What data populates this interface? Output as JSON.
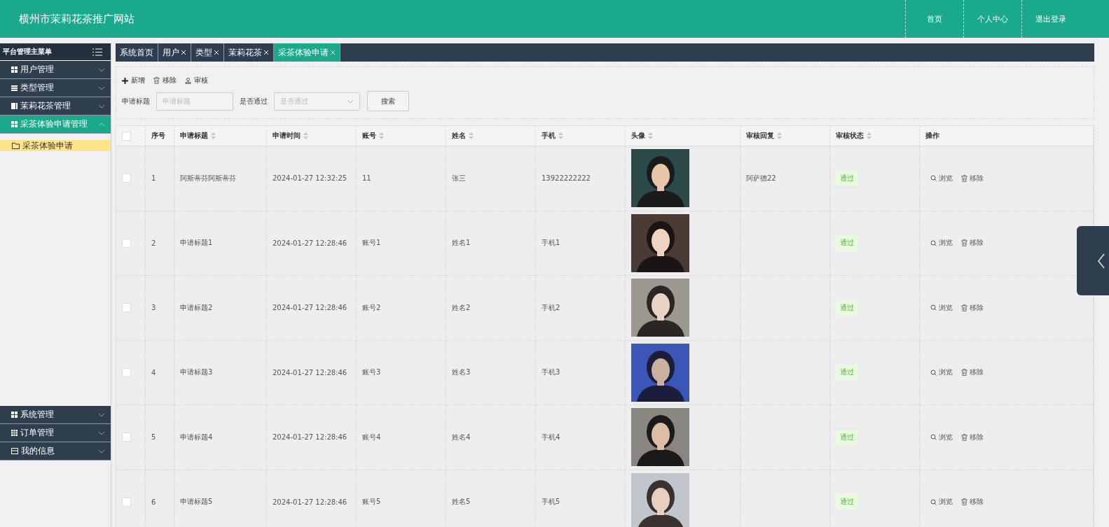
{
  "header": {
    "title": "横州市茉莉花茶推广网站",
    "nav": [
      "首页",
      "个人中心",
      "退出登录"
    ]
  },
  "sidebar": {
    "title": "平台管理主菜单",
    "top_items": [
      {
        "label": "用户管理",
        "kind": "grid",
        "expanded": false
      },
      {
        "label": "类型管理",
        "kind": "list",
        "expanded": false
      },
      {
        "label": "茉莉花茶管理",
        "kind": "book",
        "expanded": false
      },
      {
        "label": "采茶体验申请管理",
        "kind": "grid",
        "expanded": true,
        "children": [
          {
            "label": "采茶体验申请",
            "selected": true
          }
        ]
      }
    ],
    "bottom_items": [
      {
        "label": "系统管理",
        "kind": "grid",
        "expanded": false
      },
      {
        "label": "订单管理",
        "kind": "table",
        "expanded": false
      },
      {
        "label": "我的信息",
        "kind": "card",
        "expanded": false
      }
    ]
  },
  "tabs": [
    {
      "label": "系统首页",
      "closable": false,
      "selected": false
    },
    {
      "label": "用户",
      "closable": true,
      "selected": false
    },
    {
      "label": "类型",
      "closable": true,
      "selected": false
    },
    {
      "label": "茉莉花茶",
      "closable": true,
      "selected": false
    },
    {
      "label": "采茶体验申请",
      "closable": true,
      "selected": true
    }
  ],
  "toolbar": {
    "buttons": [
      {
        "label": "新增",
        "kind": "add"
      },
      {
        "label": "移除",
        "kind": "delete"
      },
      {
        "label": "审核",
        "kind": "stamp"
      }
    ],
    "search": [
      {
        "label": "申请标题",
        "kind": "input",
        "placeholder": "申请标题"
      },
      {
        "label": "是否通过",
        "kind": "select",
        "placeholder": "是否通过"
      }
    ],
    "search_button": "搜索"
  },
  "table": {
    "header_checkbox": {
      "checked": false
    },
    "columns": [
      {
        "label": "序号",
        "sortable": false
      },
      {
        "label": "申请标题",
        "sortable": true
      },
      {
        "label": "申请时间",
        "sortable": true
      },
      {
        "label": "账号",
        "sortable": true
      },
      {
        "label": "姓名",
        "sortable": true
      },
      {
        "label": "手机",
        "sortable": true
      },
      {
        "label": "头像",
        "sortable": true
      },
      {
        "label": "审核回复",
        "sortable": true
      },
      {
        "label": "审核状态",
        "sortable": true
      },
      {
        "label": "操作",
        "sortable": false
      }
    ],
    "rows": [
      {
        "checked": false,
        "index": "1",
        "title": "阿斯蒂芬阿斯蒂芬",
        "time": "2024-01-27 12:32:25",
        "account": "11",
        "name": "张三",
        "phone": "13922222222",
        "avatar": {
          "kind": "picture"
        },
        "reply": "阿萨德22",
        "status": "通过",
        "actions": [
          {
            "label": "浏览",
            "kind": "view"
          },
          {
            "label": "移除",
            "kind": "delete"
          }
        ]
      },
      {
        "checked": false,
        "index": "2",
        "title": "申请标题1",
        "time": "2024-01-27 12:28:46",
        "account": "账号1",
        "name": "姓名1",
        "phone": "手机1",
        "avatar": {
          "kind": "picture"
        },
        "status": "通过",
        "actions": [
          {
            "label": "浏览",
            "kind": "view"
          },
          {
            "label": "移除",
            "kind": "delete"
          }
        ]
      },
      {
        "checked": false,
        "index": "3",
        "title": "申请标题2",
        "time": "2024-01-27 12:28:46",
        "account": "账号2",
        "name": "姓名2",
        "phone": "手机2",
        "avatar": {
          "kind": "picture"
        },
        "status": "通过",
        "actions": [
          {
            "label": "浏览",
            "kind": "view"
          },
          {
            "label": "移除",
            "kind": "delete"
          }
        ]
      },
      {
        "checked": false,
        "index": "4",
        "title": "申请标题3",
        "time": "2024-01-27 12:28:46",
        "account": "账号3",
        "name": "姓名3",
        "phone": "手机3",
        "avatar": {
          "kind": "picture"
        },
        "status": "通过",
        "actions": [
          {
            "label": "浏览",
            "kind": "view"
          },
          {
            "label": "移除",
            "kind": "delete"
          }
        ]
      },
      {
        "checked": false,
        "index": "5",
        "title": "申请标题4",
        "time": "2024-01-27 12:28:46",
        "account": "账号4",
        "name": "姓名4",
        "phone": "手机4",
        "avatar": {
          "kind": "picture"
        },
        "status": "通过",
        "actions": [
          {
            "label": "浏览",
            "kind": "view"
          },
          {
            "label": "移除",
            "kind": "delete"
          }
        ]
      },
      {
        "checked": false,
        "index": "6",
        "title": "申请标题5",
        "time": "2024-01-27 12:28:46",
        "account": "账号5",
        "name": "姓名5",
        "phone": "手机5",
        "avatar": {
          "kind": "picture"
        },
        "status": "通过",
        "actions": [
          {
            "label": "浏览",
            "kind": "view"
          },
          {
            "label": "移除",
            "kind": "delete"
          }
        ]
      }
    ]
  }
}
